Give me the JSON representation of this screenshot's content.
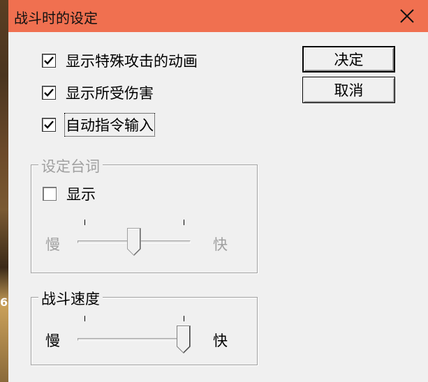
{
  "window": {
    "title": "战斗时的设定",
    "title_bar_color": "#f07050",
    "close_icon": "close-icon"
  },
  "options": [
    {
      "label": "显示特殊攻击的动画",
      "checked": true
    },
    {
      "label": "显示所受伤害",
      "checked": true
    },
    {
      "label": "自动指令输入",
      "checked": true
    }
  ],
  "buttons": {
    "ok": "决定",
    "cancel": "取消"
  },
  "dialog_group": {
    "title": "设定台词",
    "enabled": false,
    "show_label": "显示",
    "show_checked": false,
    "slow_label": "慢",
    "fast_label": "快",
    "speed_level": 0.5
  },
  "battle_group": {
    "title": "战斗速度",
    "slow_label": "慢",
    "fast_label": "快",
    "speed_level": 1.0
  },
  "background": {
    "edge_text": "6"
  }
}
